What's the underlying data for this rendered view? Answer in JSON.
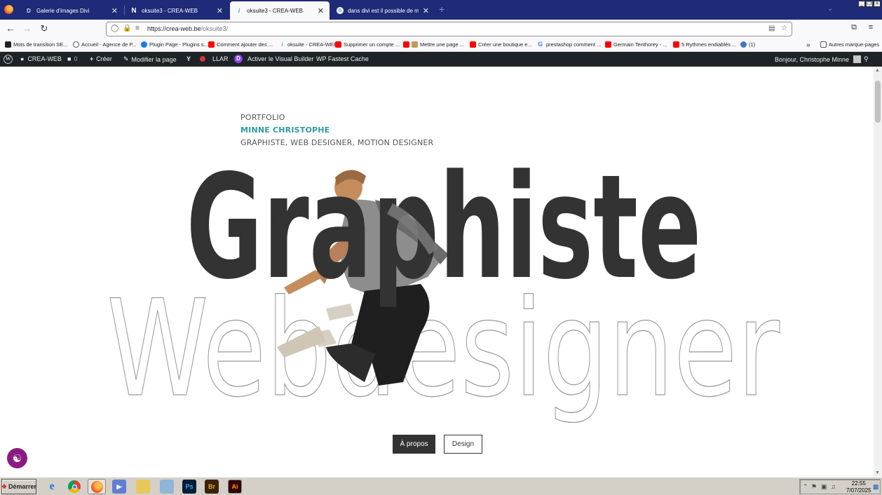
{
  "browser": {
    "tabs": [
      {
        "title": "Galerie d'images Divi",
        "favicon": "D",
        "active": false
      },
      {
        "title": "oksuite3 - CREA-WEB",
        "favicon": "N",
        "active": false
      },
      {
        "title": "oksuite3 - CREA-WEB",
        "favicon": "i",
        "active": true
      },
      {
        "title": "dans divi est il possible de mettre à",
        "favicon": "G",
        "active": false
      }
    ],
    "new_tab": "+",
    "close_glyph": "✕",
    "url_host": "https://crea-web.be",
    "url_path": "/oksuite3/",
    "bookmarks": [
      {
        "label": "Mots de transition SE...",
        "color": "#222222"
      },
      {
        "label": "Accueil - Agence de P...",
        "color": "#4a4a4a"
      },
      {
        "label": "Plugin Page - Plugins s...",
        "color": "#1877f2"
      },
      {
        "label": "Comment ajouter des ...",
        "color": "#ff0000"
      },
      {
        "label": "oksuite - CREA-WEB",
        "color": "#2e9aa3"
      },
      {
        "label": "Supprimer un compte ...",
        "color": "#ff0000"
      },
      {
        "label": "Mettre une page ...",
        "color": "#ff0000"
      },
      {
        "label": "Créer une boutique e...",
        "color": "#ff0000"
      },
      {
        "label": "prestashop comment ...",
        "color": "#4285f4"
      },
      {
        "label": "Germain Tenthorey - ...",
        "color": "#ff0000"
      },
      {
        "label": "5 Rythmes endiablés ...",
        "color": "#ff0000"
      },
      {
        "label": "(1)",
        "color": "#3a79c8"
      }
    ],
    "other_bookmarks": "Autres marque-pages"
  },
  "wp_admin_bar": {
    "site": "CREA-WEB",
    "comments": "0",
    "create": "Créer",
    "edit_page": "Modifier la page",
    "llar": "LLAR",
    "visual_builder": "Activer le Visual Builder",
    "cache": "WP Fastest Cache",
    "greeting": "Bonjour, Christophe Minne"
  },
  "page": {
    "kicker": "PORTFOLIO",
    "name": "MINNE CHRISTOPHE",
    "roles": "GRAPHISTE, WEB DESIGNER, MOTION DESIGNER",
    "hero_word_1": "Graphiste",
    "hero_word_2": "Webdesigner",
    "buttons": {
      "about": "À propos",
      "design": "Design"
    }
  },
  "taskbar": {
    "start": "Démarrer",
    "apps": [
      {
        "name": "internet-explorer",
        "label": "e",
        "color": "#1f79d6"
      },
      {
        "name": "chrome",
        "label": "",
        "color": "#db4437"
      },
      {
        "name": "firefox",
        "label": "",
        "color": "#ff7139"
      },
      {
        "name": "media-player",
        "label": "▶",
        "color": "#5f7fd0"
      },
      {
        "name": "folder",
        "label": "",
        "color": "#e8c75a"
      },
      {
        "name": "explorer",
        "label": "",
        "color": "#8fb6d8"
      },
      {
        "name": "photoshop",
        "label": "Ps",
        "color": "#001e36"
      },
      {
        "name": "bridge",
        "label": "Br",
        "color": "#3a2308"
      },
      {
        "name": "illustrator",
        "label": "Ai",
        "color": "#330000"
      }
    ],
    "time": "22:55",
    "date": "7/07/2025"
  }
}
